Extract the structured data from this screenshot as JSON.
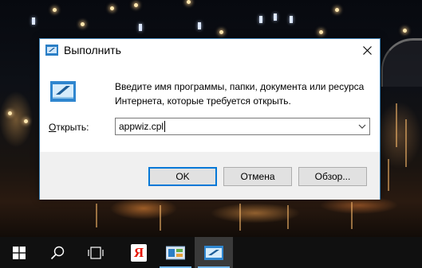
{
  "dialog": {
    "title": "Выполнить",
    "description": "Введите имя программы, папки, документа или ресурса Интернета, которые требуется открыть.",
    "open_label_mnemonic": "О",
    "open_label_rest": "ткрыть:",
    "input_value": "appwiz.cpl",
    "ok_label": "OK",
    "cancel_label": "Отмена",
    "browse_label": "Обзор..."
  },
  "colors": {
    "accent": "#0078d7",
    "dialog_border": "#3c7fb1",
    "taskbar": "#101010"
  },
  "taskbar": {
    "items": [
      {
        "icon": "windows-start-icon"
      },
      {
        "icon": "search-icon"
      },
      {
        "icon": "task-view-icon"
      },
      {
        "icon": "yandex-browser-icon",
        "text": "Я"
      },
      {
        "icon": "control-panel-icon"
      },
      {
        "icon": "run-icon"
      }
    ]
  }
}
